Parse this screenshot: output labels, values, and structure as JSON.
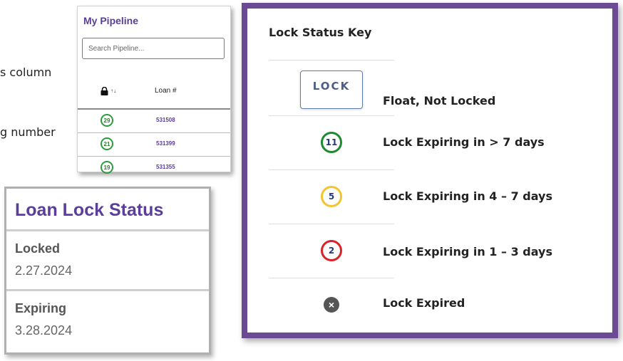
{
  "background_text": {
    "line1": "s column",
    "line2": "g number"
  },
  "pipeline": {
    "title": "My Pipeline",
    "search_placeholder": "Search Pipeline...",
    "columns": {
      "lock": "lock-icon",
      "loan": "Loan #"
    },
    "rows": [
      {
        "days": "29",
        "loan": "531508"
      },
      {
        "days": "21",
        "loan": "531399"
      },
      {
        "days": "19",
        "loan": "531355"
      }
    ],
    "days_color": "#2e9b3e"
  },
  "loan_lock_status": {
    "title": "Loan Lock Status",
    "locked_label": "Locked",
    "locked_date": "2.27.2024",
    "expiring_label": "Expiring",
    "expiring_date": "3.28.2024",
    "title_color": "#5a3e9a"
  },
  "lock_status_key": {
    "title": "Lock Status Key",
    "border_color": "#6a4a93",
    "items": [
      {
        "icon": "LOCK",
        "label": "Float, Not Locked"
      },
      {
        "icon": "11",
        "label": "Lock Expiring in > 7 days",
        "color": "#1e8a2e"
      },
      {
        "icon": "5",
        "label": "Lock Expiring in 4 – 7 days",
        "color": "#f2c530"
      },
      {
        "icon": "2",
        "label": "Lock Expiring in 1 – 3 days",
        "color": "#d8232a"
      },
      {
        "icon": "expired-x-icon",
        "label": "Lock Expired"
      }
    ]
  }
}
